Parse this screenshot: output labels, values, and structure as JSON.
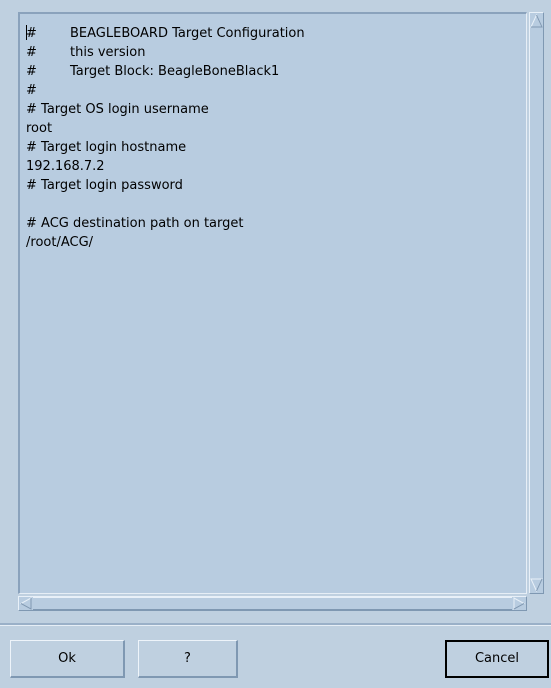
{
  "editor": {
    "lines": [
      {
        "hash": "#",
        "text": "BEAGLEBOARD Target Configuration"
      },
      {
        "hash": "#",
        "text": "this version"
      },
      {
        "hash": "#",
        "text": "Target Block: BeagleBoneBlack1"
      },
      {
        "hash": "#",
        "text": ""
      },
      {
        "hash": "",
        "text": "# Target OS login username"
      },
      {
        "hash": "",
        "text": "root"
      },
      {
        "hash": "",
        "text": "# Target login hostname"
      },
      {
        "hash": "",
        "text": "192.168.7.2"
      },
      {
        "hash": "",
        "text": "# Target login password"
      },
      {
        "hash": "",
        "text": ""
      },
      {
        "hash": "",
        "text": "# ACG destination path on target"
      },
      {
        "hash": "",
        "text": "/root/ACG/"
      }
    ]
  },
  "buttons": {
    "ok_label": "Ok",
    "help_label": "?",
    "cancel_label": "Cancel"
  },
  "icons": {
    "scroll_up": "arrow-up-icon",
    "scroll_down": "arrow-down-icon",
    "scroll_left": "arrow-left-icon",
    "scroll_right": "arrow-right-icon"
  },
  "colors": {
    "background": "#bfd0e0",
    "editor_background": "#b8cce0"
  }
}
